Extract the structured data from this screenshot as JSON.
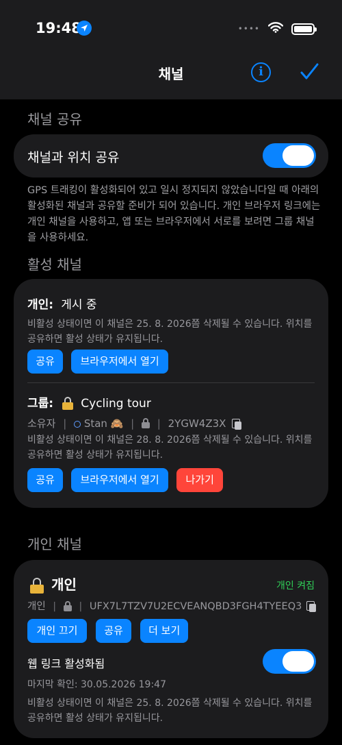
{
  "status_bar": {
    "time": "19:48",
    "dots": "••••"
  },
  "nav": {
    "title": "채널",
    "info_glyph": "i"
  },
  "sharing": {
    "header": "채널 공유",
    "toggle_label": "채널과 위치 공유",
    "toggle_on": true,
    "description": "GPS 트래킹이 활성화되어 있고 일시 정지되지 않았습니다일 때 아래의 활성화된 채널과 공유할 준비가 되어 있습니다. 개인 브라우저 링크에는 개인 채널을 사용하고, 앱 또는 브라우저에서 서로를 보려면 그룹 채널을 사용하세요."
  },
  "active": {
    "header": "활성 채널",
    "personal": {
      "label": "개인:",
      "status": "게시 중",
      "note": "비활성 상태이면 이 채널은 25. 8. 2026쯤 삭제될 수 있습니다. 위치를 공유하면 활성 상태가 유지됩니다.",
      "btn_share": "공유",
      "btn_open": "브라우저에서 열기"
    },
    "group": {
      "label": "그룹:",
      "name": "Cycling tour",
      "owner_label": "소유자",
      "owner_name": "Stan",
      "owner_emoji": "🙈",
      "code": "2YGW4Z3X",
      "note": "비활성 상태이면 이 채널은 28. 8. 2026쯤 삭제될 수 있습니다. 위치를 공유하면 활성 상태가 유지됩니다.",
      "btn_share": "공유",
      "btn_open": "브라우저에서 열기",
      "btn_leave": "나가기"
    }
  },
  "private_section": {
    "header": "개인 채널",
    "title": "개인",
    "state": "개인 켜짐",
    "kind": "개인",
    "code": "UFX7L7TZV7U2ECVEANQBD3FGH4TYEEQ3",
    "btn_off": "개인 끄기",
    "btn_share": "공유",
    "btn_more": "더 보기",
    "weblink_label": "웹 링크 활성화됨",
    "weblink_on": true,
    "last_seen": "마지막 확인: 30.05.2026 19:47",
    "note": "비활성 상태이면 이 채널은 25. 8. 2026쯤 삭제될 수 있습니다. 위치를 공유하면 활성 상태가 유지됩니다."
  },
  "colors": {
    "accent": "#0a84ff",
    "danger": "#ff453a",
    "success": "#30d158",
    "card": "#1c1c1e"
  },
  "icons": [
    "location-arrow-icon",
    "signal-icon",
    "wifi-icon",
    "battery-icon",
    "info-icon",
    "checkmark-icon",
    "lock-icon",
    "copy-icon",
    "presence-dot-icon"
  ]
}
